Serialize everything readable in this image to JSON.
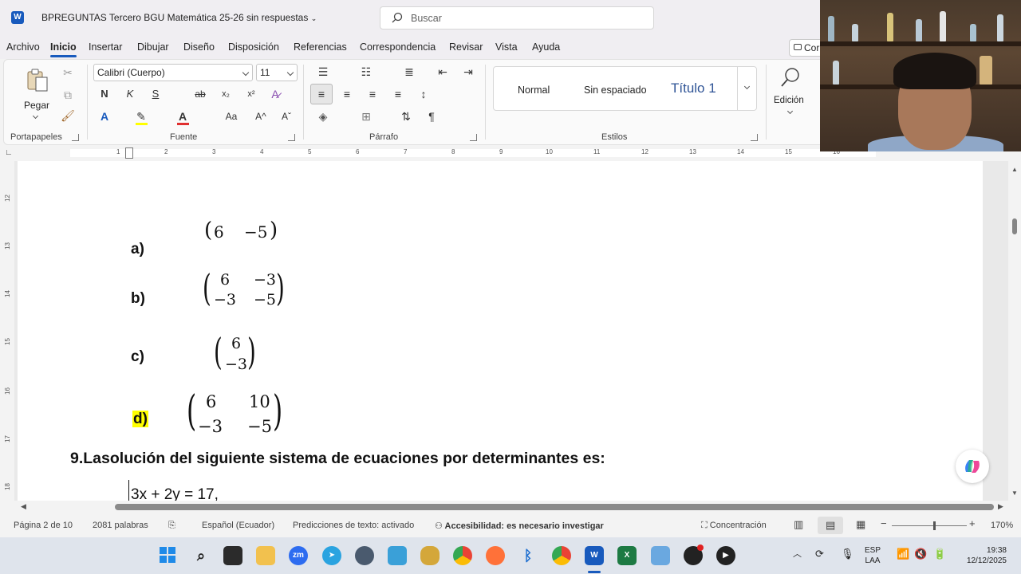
{
  "titlebar": {
    "doc_title": "BPREGUNTAS  Tercero BGU Matemática 25-26 sin respuestas",
    "search_placeholder": "Buscar"
  },
  "menu": {
    "tabs": [
      "Archivo",
      "Inicio",
      "Insertar",
      "Dibujar",
      "Diseño",
      "Disposición",
      "Referencias",
      "Correspondencia",
      "Revisar",
      "Vista",
      "Ayuda"
    ],
    "share_label": "Cor"
  },
  "ribbon": {
    "paste_label": "Pegar",
    "font_name": "Calibri (Cuerpo)",
    "font_size": "11",
    "bold": "N",
    "italic": "K",
    "underline": "S",
    "strike": "ab",
    "subscript": "x₂",
    "superscript": "x²",
    "change_case": "Aa",
    "grow": "A^",
    "shrink": "Aˇ",
    "styles": [
      "Normal",
      "Sin espaciado",
      "Título 1"
    ],
    "edit_label": "Edición",
    "groups": [
      "Portapapeles",
      "Fuente",
      "Párrafo",
      "Estilos"
    ]
  },
  "ruler": {
    "numbers": [
      "1",
      "2",
      "3",
      "4",
      "5",
      "6",
      "7",
      "8",
      "9",
      "10",
      "11",
      "12",
      "13",
      "14",
      "15",
      "16"
    ],
    "vertical_numbers": [
      "12",
      "13",
      "14",
      "15",
      "16",
      "17",
      "18"
    ]
  },
  "document": {
    "options": [
      {
        "label": "a)",
        "matrix": [
          [
            "6",
            "−5"
          ]
        ]
      },
      {
        "label": "b)",
        "matrix": [
          [
            "6",
            "−3"
          ],
          [
            "−3",
            "−5"
          ]
        ]
      },
      {
        "label": "c)",
        "matrix": [
          [
            "6"
          ],
          [
            "−3"
          ]
        ]
      },
      {
        "label": "d)",
        "matrix": [
          [
            "6",
            "10"
          ],
          [
            "−3",
            "−5"
          ]
        ]
      }
    ],
    "question": "9.Lasolución del siguiente sistema de ecuaciones por determinantes es:",
    "equation": "3x + 2y = 17,"
  },
  "statusbar": {
    "page": "Página 2 de 10",
    "words": "2081 palabras",
    "language": "Español (Ecuador)",
    "predictions": "Predicciones de texto: activado",
    "accessibility": "Accesibilidad: es necesario investigar",
    "focus": "Concentración",
    "zoom": "170%"
  },
  "taskbar": {
    "lang_top": "ESP",
    "lang_bottom": "LAA",
    "time": "19:38",
    "date": "12/12/2025"
  },
  "colors": {
    "accent": "#185abd",
    "highlight": "#ffff00",
    "heading_style": "#2f5496"
  }
}
